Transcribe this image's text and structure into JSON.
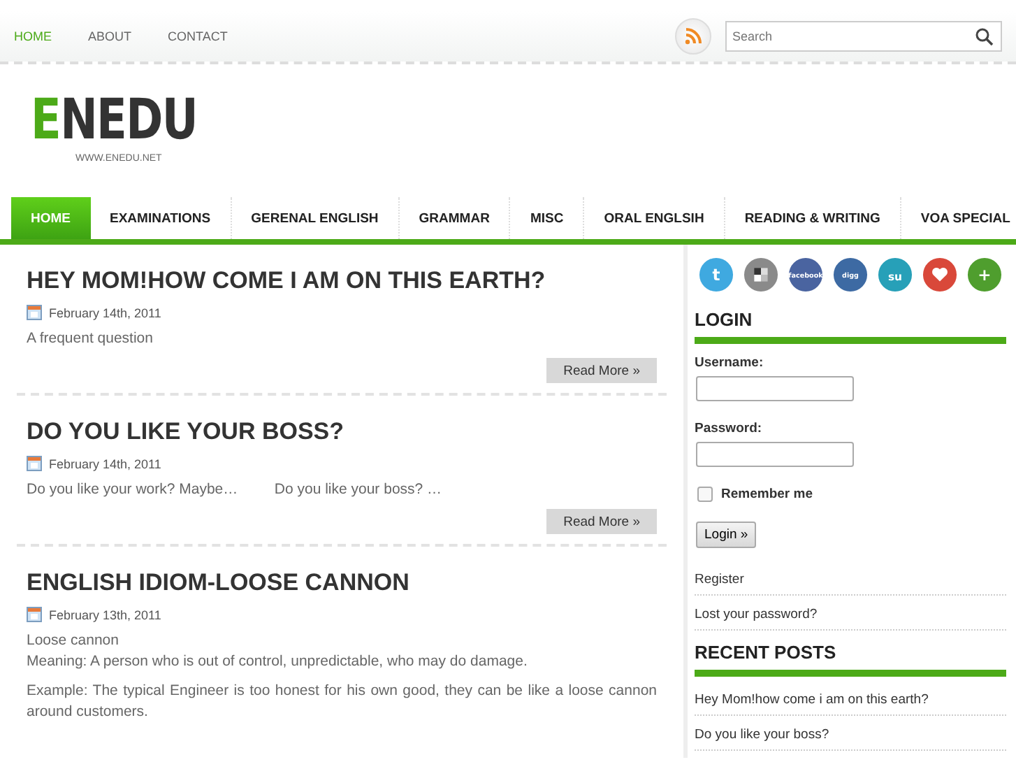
{
  "top_menu": [
    {
      "label": "HOME",
      "selected": true
    },
    {
      "label": "ABOUT",
      "selected": false
    },
    {
      "label": "CONTACT",
      "selected": false
    }
  ],
  "search": {
    "placeholder": "Search"
  },
  "logo": {
    "first_letter": "E",
    "rest": "NEDU",
    "url": "WWW.ENEDU.NET"
  },
  "nav": [
    {
      "label": "HOME",
      "selected": true
    },
    {
      "label": "EXAMINATIONS",
      "selected": false
    },
    {
      "label": "GERENAL ENGLISH",
      "selected": false
    },
    {
      "label": "GRAMMAR",
      "selected": false
    },
    {
      "label": "MISC",
      "selected": false
    },
    {
      "label": "ORAL ENGLSIH",
      "selected": false
    },
    {
      "label": "READING & WRITING",
      "selected": false
    },
    {
      "label": "VOA SPECIAL",
      "selected": false
    }
  ],
  "posts": [
    {
      "title": "HEY MOM!HOW COME I AM ON THIS EARTH?",
      "date": "February 14th, 2011",
      "paragraphs": [
        "A frequent question"
      ],
      "read_more": "Read More »"
    },
    {
      "title": "DO YOU LIKE YOUR BOSS?",
      "date": "February 14th, 2011",
      "paragraphs": [
        "Do you like your work? Maybe…         Do you like your boss? …"
      ],
      "read_more": "Read More »"
    },
    {
      "title": "ENGLISH IDIOM-LOOSE CANNON",
      "date": "February 13th, 2011",
      "paragraphs": [
        "Loose cannon\nMeaning: A person who is out of control, unpredictable, who may do damage.",
        "Example: The typical Engineer is too honest for his own good, they can be like a loose cannon around customers."
      ]
    }
  ],
  "social": [
    {
      "kind": "glyph",
      "label": "t",
      "color": "#3fa9e0"
    },
    {
      "kind": "squares",
      "color": "#8a8a8a"
    },
    {
      "kind": "glyph",
      "label": "facebook",
      "color": "#4a64a0"
    },
    {
      "kind": "glyph",
      "label": "digg",
      "color": "#3d6aa3"
    },
    {
      "kind": "glyph",
      "label": "su",
      "color": "#27a0b8"
    },
    {
      "kind": "heart",
      "color": "#d9483a"
    },
    {
      "kind": "glyph",
      "label": "+",
      "color": "#4f9e2e"
    }
  ],
  "login": {
    "heading": "LOGIN",
    "username_label": "Username:",
    "password_label": "Password:",
    "remember": {
      "label": "Remember me",
      "checked": false
    },
    "button": "Login »",
    "links": [
      "Register",
      "Lost your password?"
    ]
  },
  "recent": {
    "heading": "RECENT POSTS",
    "items": [
      "Hey Mom!how come i am on this earth?",
      "Do you like your boss?"
    ]
  }
}
